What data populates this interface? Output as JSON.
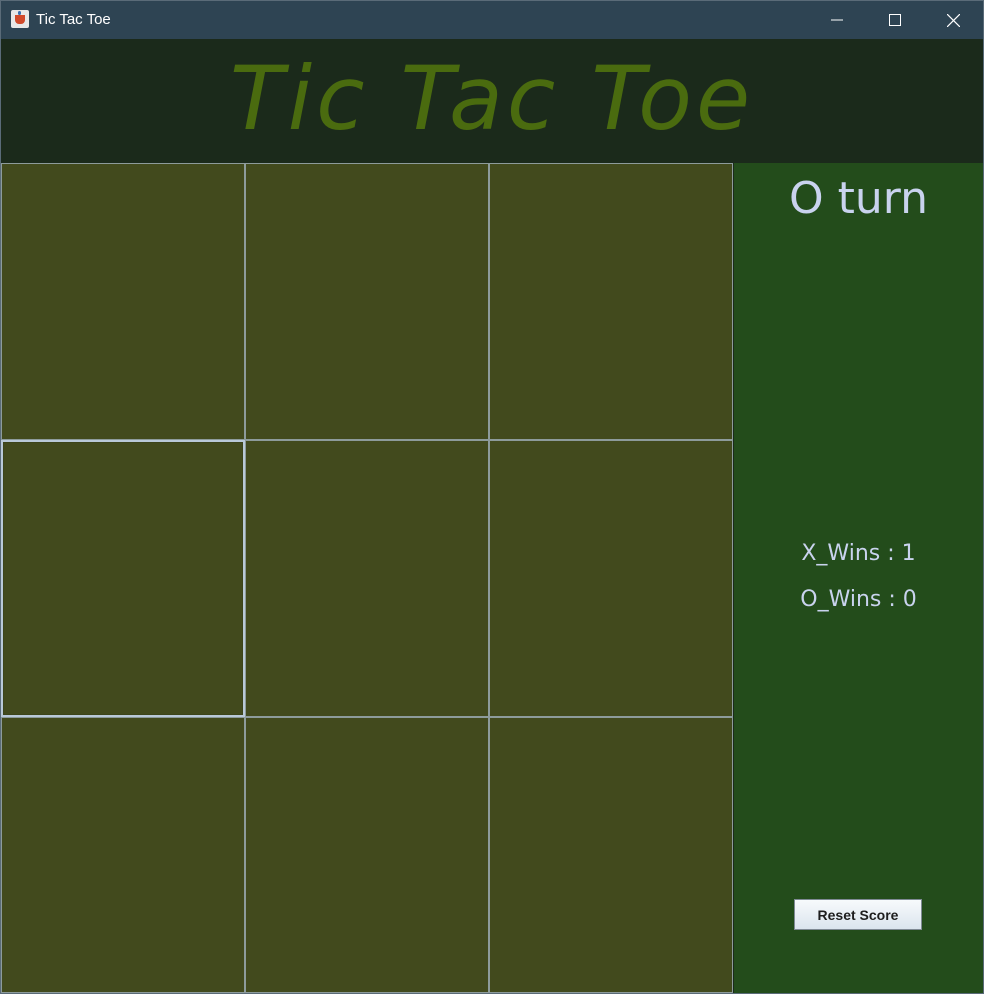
{
  "window": {
    "title": "Tic Tac Toe",
    "icon": "java-app-icon"
  },
  "header": {
    "title": "Tic Tac Toe"
  },
  "board": {
    "cells": [
      "",
      "",
      "",
      "",
      "",
      "",
      "",
      "",
      ""
    ],
    "focused_cell": 3
  },
  "side": {
    "turn": "O turn",
    "x_wins": "X_Wins : 1",
    "o_wins": "O_Wins : 0",
    "reset_label": "Reset Score"
  },
  "colors": {
    "header_bg": "#1b2a1b",
    "title_color": "#4a6b0f",
    "cell_bg": "#424a1d",
    "side_bg": "#234c1b",
    "text_light": "#c9d3ee"
  }
}
